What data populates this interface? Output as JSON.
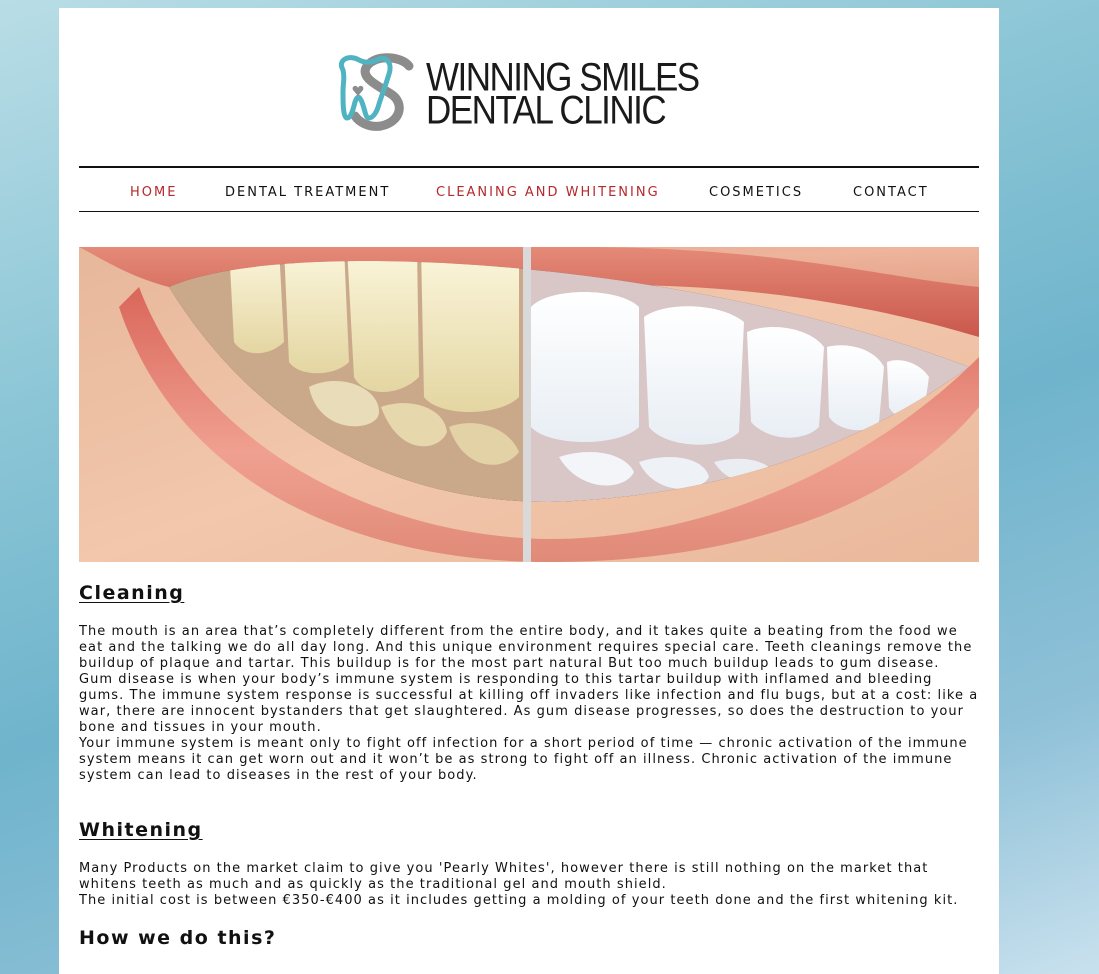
{
  "logo": {
    "line1": "WINNING SMILES",
    "line2": "DENTAL CLINIC",
    "colors": {
      "teal": "#4fb3c2",
      "gray": "#8c8c8c",
      "text": "#1a1a1a"
    }
  },
  "nav": {
    "items": [
      {
        "label": "HOME",
        "active": true
      },
      {
        "label": "DENTAL TREATMENT",
        "active": false
      },
      {
        "label": "CLEANING AND WHITENING",
        "active": true
      },
      {
        "label": "COSMETICS",
        "active": false
      },
      {
        "label": "CONTACT",
        "active": false
      }
    ],
    "active_color": "#b5282c"
  },
  "hero": {
    "description_icon": "teeth-whitening-before-after-image"
  },
  "sections": {
    "cleaning": {
      "title": "Cleaning",
      "paragraphs": [
        "The mouth is an area that’s completely different from the entire body, and it takes quite a beating from the food we eat and the talking we do all day long. And this unique environment requires special care. Teeth cleanings remove the buildup of plaque and tartar. This buildup is for the most part natural But too much buildup leads to gum disease.",
        "Gum disease is when your body’s immune system is responding to this tartar buildup with inflamed and bleeding gums. The immune system response is successful at killing off invaders like infection and flu bugs, but at a cost: like a war, there are innocent bystanders that get slaughtered. As gum disease progresses, so does the destruction to your bone and tissues in your mouth.",
        "Your immune system is meant only to fight off infection for a short period of time — chronic activation of the immune system means it can get worn out and it won’t be as strong to fight off an illness. Chronic activation of the immune system can lead to diseases in the rest of your body."
      ]
    },
    "whitening": {
      "title": "Whitening",
      "paragraphs": [
        "Many Products on the market claim to give you 'Pearly Whites', however there is still nothing on the market that whitens teeth as much and as quickly as the traditional gel and mouth shield.",
        "The initial cost is between €350-€400 as it includes getting a molding of your teeth done and the first whitening kit."
      ]
    },
    "how": {
      "title": "How we do this?"
    }
  }
}
